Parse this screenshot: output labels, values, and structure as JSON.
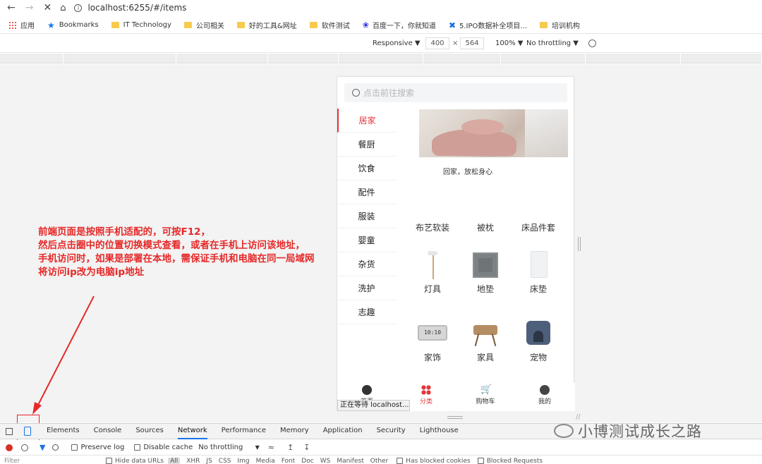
{
  "browser": {
    "url": "localhost:6255/#/items",
    "bookmarks": [
      "应用",
      "Bookmarks",
      "IT Technology",
      "公司相关",
      "好的工具&网址",
      "软件测试",
      "百度一下，你就知道",
      "5.IPO数据补全项目...",
      "培训机构"
    ]
  },
  "device_toolbar": {
    "mode": "Responsive ▼",
    "width": "400",
    "times": "×",
    "height": "564",
    "zoom": "100% ▼",
    "throttle": "No throttling ▼"
  },
  "phone": {
    "search_placeholder": "点击前往搜索",
    "categories": [
      "居家",
      "餐厨",
      "饮食",
      "配件",
      "服装",
      "婴童",
      "杂货",
      "洗护",
      "志趣"
    ],
    "active_category": "居家",
    "banner_caption": "回家，放松身心",
    "items": [
      "布艺软装",
      "被枕",
      "床品件套",
      "灯具",
      "地垫",
      "床垫",
      "家饰",
      "家具",
      "宠物"
    ],
    "tabs": [
      "首页",
      "分类",
      "购物车",
      "我的"
    ],
    "waiting_text": "正在等待 localhost..."
  },
  "annotation": {
    "lines": [
      "前端页面是按照手机适配的，可按F12，",
      "然后点击圈中的位置切换模式查看，或者在手机上访问该地址，",
      "手机访问时，如果是部署在本地，需保证手机和电脑在同一局域网",
      "将访问ip改为电脑ip地址"
    ]
  },
  "devtools": {
    "tabs": [
      "Elements",
      "Console",
      "Sources",
      "Network",
      "Performance",
      "Memory",
      "Application",
      "Security",
      "Lighthouse"
    ],
    "active_tab": "Network",
    "preserve_log": "Preserve log",
    "disable_cache": "Disable cache",
    "throttling": "No throttling",
    "filter_placeholder": "Filter",
    "hide_data_urls": "Hide data URLs",
    "filter_types": [
      "All",
      "XHR",
      "JS",
      "CSS",
      "Img",
      "Media",
      "Font",
      "Doc",
      "WS",
      "Manifest",
      "Other"
    ],
    "has_blocked_cookies": "Has blocked cookies",
    "blocked_requests": "Blocked Requests"
  },
  "watermark": "小博测试成长之路",
  "colors": {
    "accent_red": "#e5353a",
    "annotation_red": "#e62929",
    "devtools_blue": "#1a73e8"
  }
}
